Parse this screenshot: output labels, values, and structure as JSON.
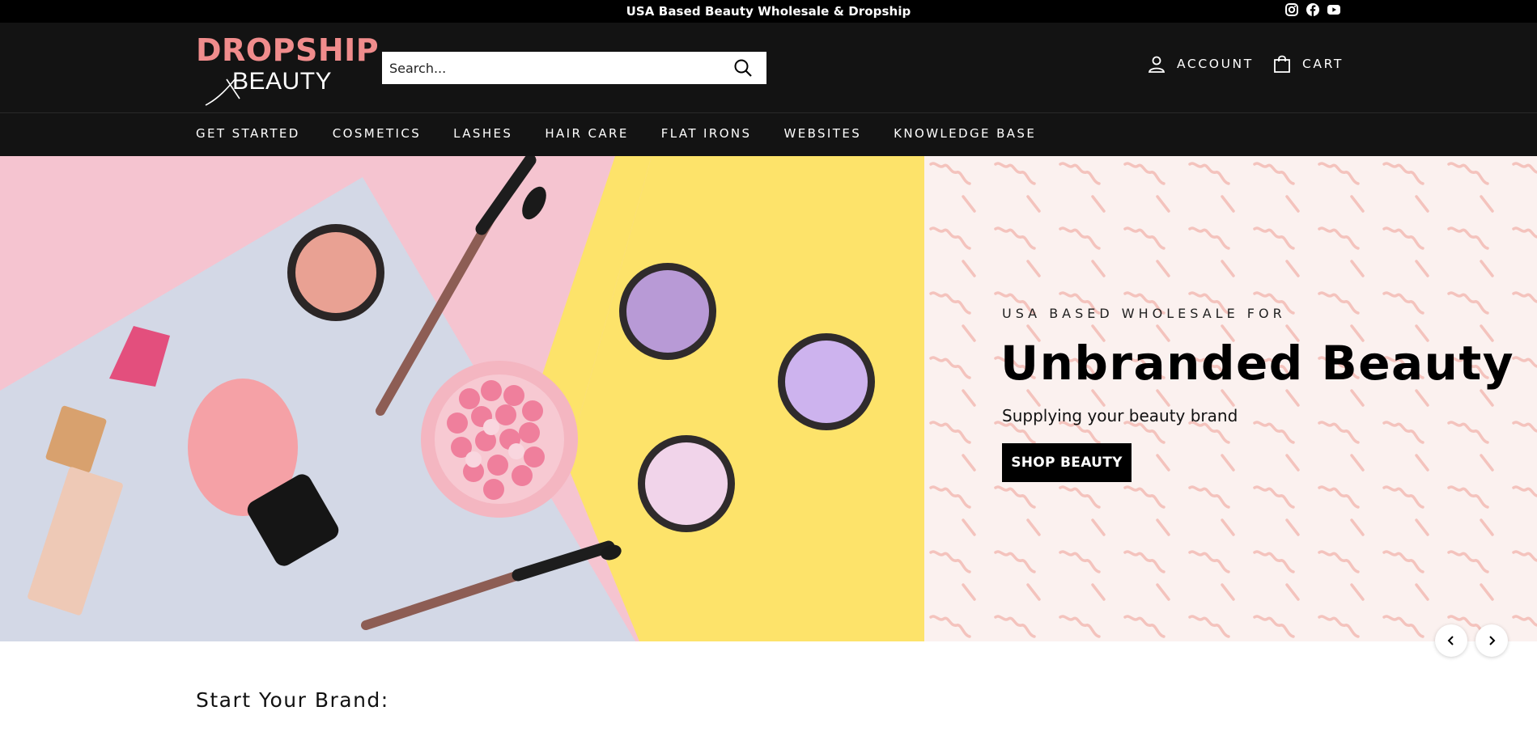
{
  "announcement": {
    "text": "USA Based Beauty Wholesale & Dropship",
    "social": [
      "instagram-icon",
      "facebook-icon",
      "youtube-icon"
    ]
  },
  "header": {
    "logo_top": "DROPSHIP",
    "logo_bottom": "BEAUTY",
    "search_placeholder": "Search...",
    "account_label": "ACCOUNT",
    "cart_label": "CART"
  },
  "nav": {
    "items": [
      {
        "label": "GET STARTED"
      },
      {
        "label": "COSMETICS"
      },
      {
        "label": "LASHES"
      },
      {
        "label": "HAIR CARE"
      },
      {
        "label": "FLAT IRONS"
      },
      {
        "label": "WEBSITES"
      },
      {
        "label": "KNOWLEDGE BASE"
      }
    ]
  },
  "hero": {
    "subheading": "USA BASED WHOLESALE FOR",
    "title": "Unbranded Beauty",
    "text": "Supplying your beauty brand",
    "button_label": "SHOP BEAUTY"
  },
  "section": {
    "title": "Start Your Brand:"
  },
  "colors": {
    "topbar": "#000000",
    "header": "#131313",
    "logo_accent": "#f08c8c",
    "panel_bg": "#fbf1ef",
    "wave": "#f4c3bd"
  }
}
